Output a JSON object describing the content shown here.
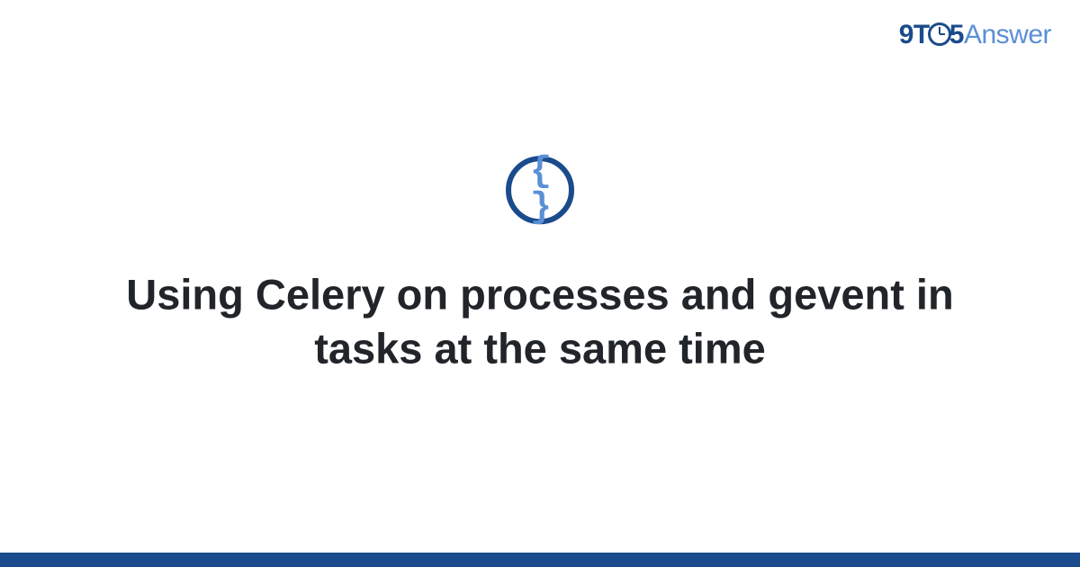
{
  "logo": {
    "part1": "9T",
    "part2": "5",
    "part3": "Answer"
  },
  "category": {
    "icon_glyph": "{ }",
    "icon_name": "code-braces"
  },
  "title": "Using Celery on processes and gevent in tasks at the same time",
  "colors": {
    "brand_dark": "#1a4b8c",
    "brand_light": "#5a8fd6",
    "text": "#212529"
  }
}
